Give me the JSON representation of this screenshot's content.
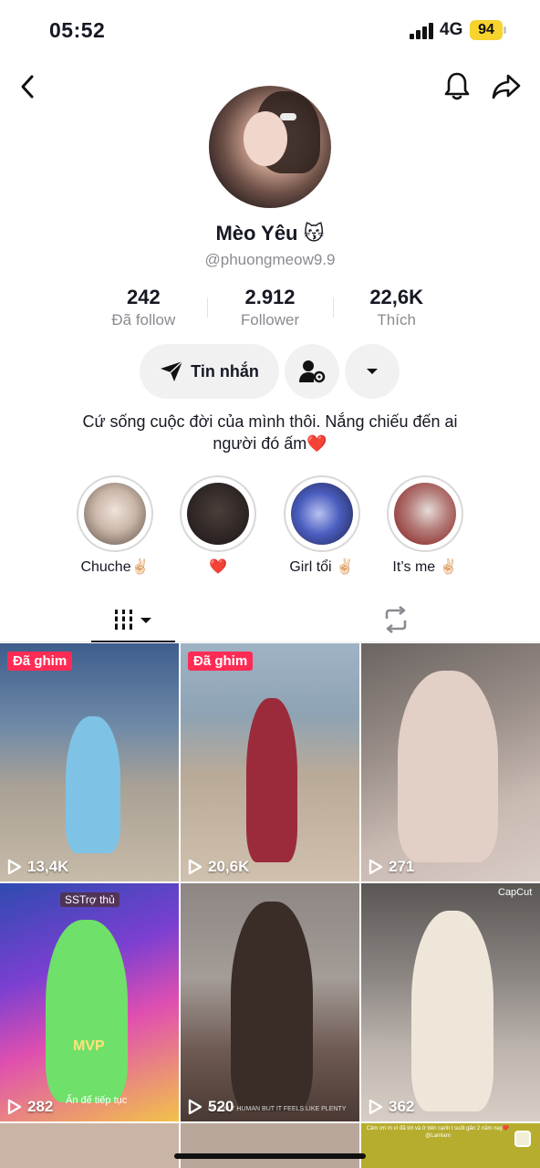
{
  "status_bar": {
    "time": "05:52",
    "network": "4G",
    "battery": "94"
  },
  "profile": {
    "display_name": "Mèo Yêu 😽",
    "username": "@phuongmeow9.9",
    "bio_line1": "Cứ sống cuộc đời của mình thôi. Nắng chiếu đến ai",
    "bio_line2": "người đó ấm❤️"
  },
  "stats": [
    {
      "value": "242",
      "label": "Đã follow"
    },
    {
      "value": "2.912",
      "label": "Follower"
    },
    {
      "value": "22,6K",
      "label": "Thích"
    }
  ],
  "actions": {
    "message_label": "Tin nhắn"
  },
  "highlights": [
    {
      "label": "Chuche✌🏻",
      "color": "#c9b6a8"
    },
    {
      "label": "❤️",
      "color": "#2e2624"
    },
    {
      "label": "Girl tổi ✌🏻",
      "color": "#4b5ec0"
    },
    {
      "label": "It’s me ✌🏻",
      "color": "#9a4a48"
    }
  ],
  "videos": [
    {
      "views": "13,4K",
      "pinned": "Đã ghim",
      "bg": "linear-gradient(180deg,#3e5d8c 0%,#6f8aa8 35%,#a9a195 60%,#c7bba9 100%)",
      "figure": "#7ec3e6"
    },
    {
      "views": "20,6K",
      "pinned": "Đã ghim",
      "bg": "linear-gradient(180deg,#9fb3c4 0%,#8ea3b4 30%,#b9aa98 55%,#d0c1ae 100%)",
      "figure": "#9b2b3b"
    },
    {
      "views": "271",
      "bg": "linear-gradient(160deg,#6a6461 0%,#9b8f89 40%,#c8b9b1 70%,#d9ccc5 100%)",
      "figure": "#e2cfc5"
    },
    {
      "views": "282",
      "bg": "linear-gradient(160deg,#2e4bb0 0%,#7b3fd1 35%,#e04fb0 60%,#f2c24a 100%)",
      "figure": "#6fe06a",
      "overlay_top": "SSTrợ thủ",
      "overlay_mid": "MVP",
      "overlay_bottom": "Ấn để tiếp tục"
    },
    {
      "views": "520",
      "bg": "linear-gradient(180deg,#8d8683 0%,#a49c97 40%,#6e5a52 70%,#4a3a33 100%)",
      "figure": "#3a2d28",
      "overlay_bottom": "I'M ONLY HUMAN BUT IT FEELS LIKE PLENTY"
    },
    {
      "views": "362",
      "bg": "linear-gradient(180deg,#5a5654 0%,#8d8784 40%,#bdb5ae 70%,#d8cec6 100%)",
      "figure": "#efe6da",
      "overlay_top": "CapCut"
    }
  ],
  "partial_row": [
    {
      "bg": "#c9b4a6"
    },
    {
      "bg": "#b8a79a"
    },
    {
      "bg": "#b6ad2f",
      "caption": "Cảm ơn m vì đã tới và ở bên cạnh t suốt gần 2 năm nay❤️ @Lamlam"
    }
  ]
}
